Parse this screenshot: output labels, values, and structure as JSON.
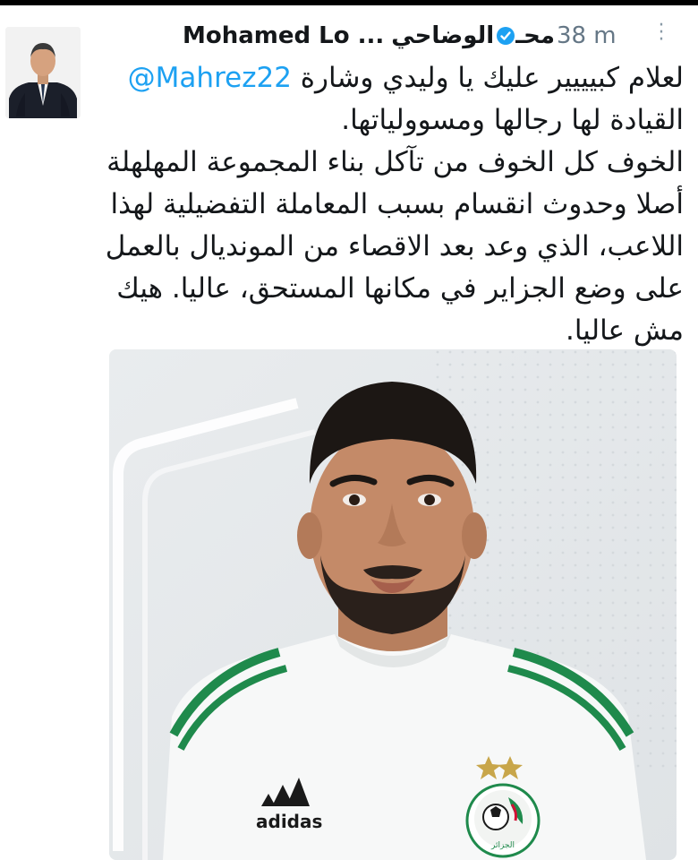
{
  "tweet": {
    "author_name": "Mohamed Lo ...",
    "author_name_arabic": "الوضاحي",
    "author_name_arabic_cut": "محـ",
    "time": "38 m",
    "mention": "@Mahrez22",
    "lines": [
      "لعلام كبيييير عليك يا وليدي وشارة",
      "القيادة لها رجالها ومسوولياتها.",
      "الخوف كل الخوف من تآكل بناء المجموعة المهلهلة",
      "أصلا وحدوث انقسام بسبب المعاملة التفضيلية لهذا",
      "اللاعب، الذي وعد بعد الاقصاء من المونديال بالعمل",
      "على وضع الجزاير في مكانها المستحق، عاليا. هيك",
      "مش عاليا."
    ]
  },
  "media": {
    "jersey_brand": "adidas",
    "crest_text": "الجزائر"
  },
  "icons": {
    "verified": "verified-badge-icon",
    "more": "more-options-icon"
  },
  "colors": {
    "link": "#1da1f2",
    "text": "#14171a",
    "muted": "#657786",
    "jersey_green": "#1f8a4c"
  }
}
